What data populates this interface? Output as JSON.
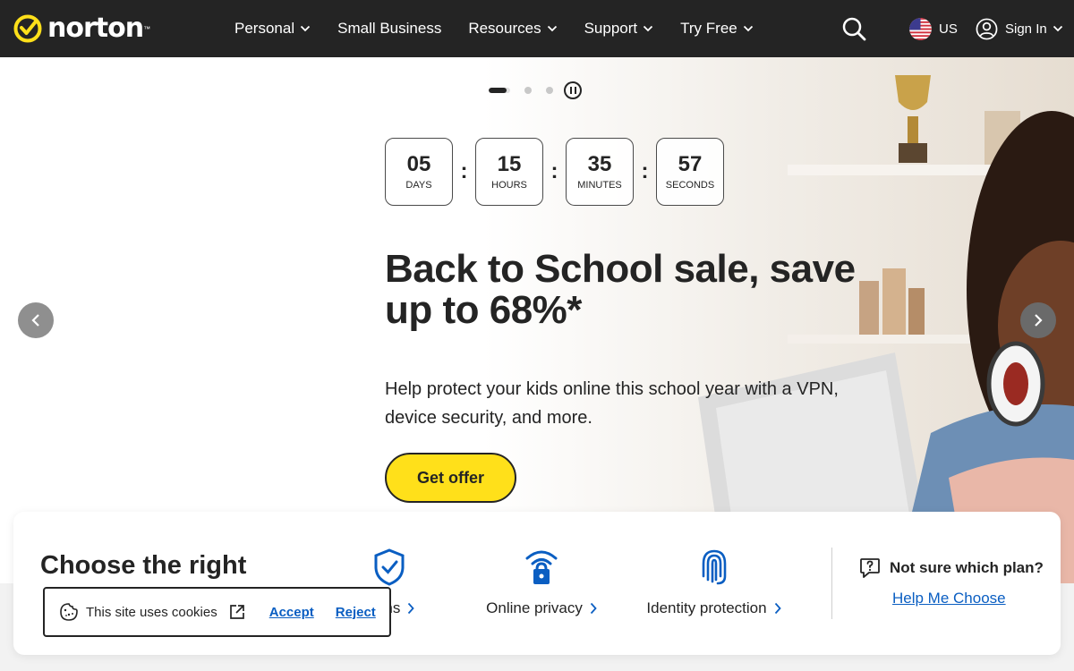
{
  "brand": {
    "logo_text": "norton",
    "accent": "#ffe01a",
    "header_bg": "#242424"
  },
  "nav": {
    "items": [
      {
        "label": "Personal",
        "has_dropdown": true
      },
      {
        "label": "Small Business",
        "has_dropdown": false
      },
      {
        "label": "Resources",
        "has_dropdown": true
      },
      {
        "label": "Support",
        "has_dropdown": true
      },
      {
        "label": "Try Free",
        "has_dropdown": true
      }
    ],
    "region": "US",
    "signin": "Sign In"
  },
  "hero": {
    "carousel": {
      "slide_count": 3,
      "active_index": 0
    },
    "countdown": {
      "days": "05",
      "days_label": "DAYS",
      "hours": "15",
      "hours_label": "HOURS",
      "minutes": "35",
      "minutes_label": "MINUTES",
      "seconds": "57",
      "seconds_label": "SECONDS",
      "separator": ":"
    },
    "headline": "Back to School sale, save up to 68%*",
    "subtext": "Help protect your kids online this school year with a VPN, device security, and more.",
    "cta": "Get offer"
  },
  "plans": {
    "title_line1": "Choose the right",
    "links": [
      {
        "label": "plans",
        "icon": "shield-check-icon"
      },
      {
        "label": "Online privacy",
        "icon": "wifi-lock-icon"
      },
      {
        "label": "Identity protection",
        "icon": "fingerprint-icon"
      }
    ],
    "help_question": "Not sure which plan?",
    "help_link": "Help Me Choose"
  },
  "cookie": {
    "text": "This site uses cookies",
    "accept": "Accept",
    "reject": "Reject"
  },
  "colors": {
    "link": "#0a5ec2",
    "icon_blue": "#0a5ec2"
  }
}
